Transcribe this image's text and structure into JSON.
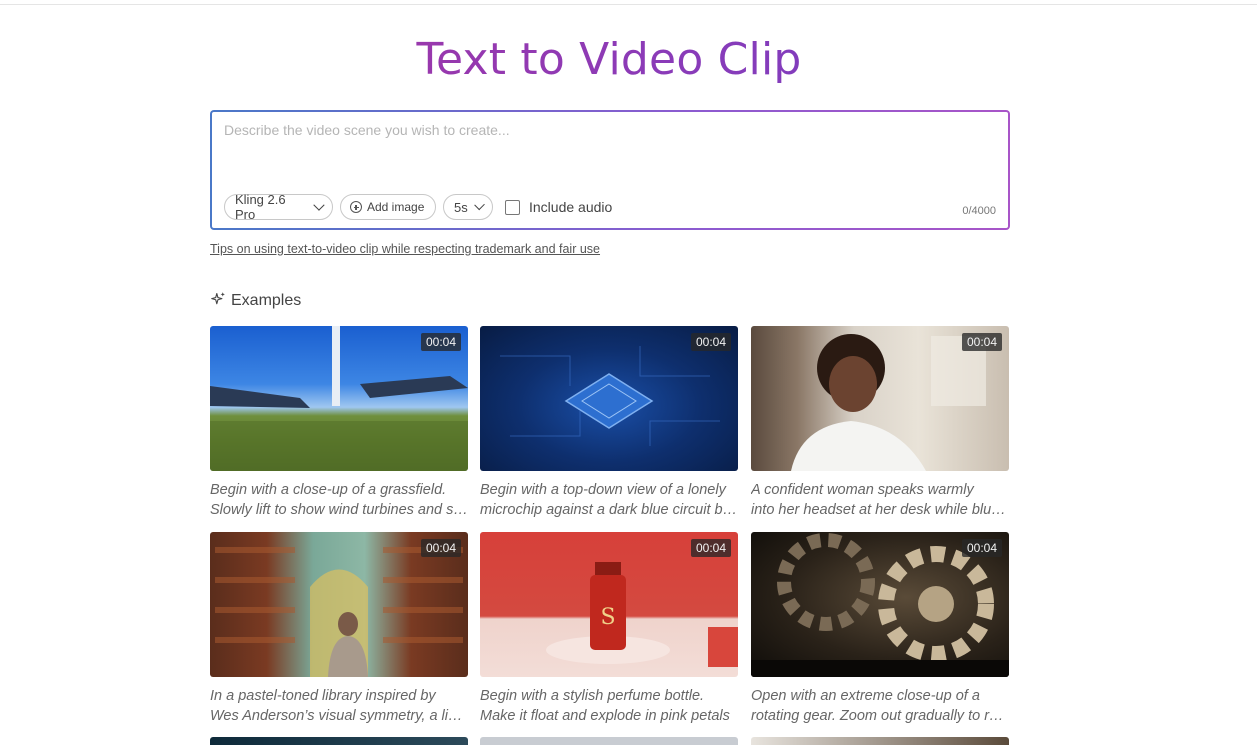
{
  "page": {
    "title": "Text to Video Clip"
  },
  "prompt": {
    "placeholder": "Describe the video scene you wish to create...",
    "model_label": "Kling 2.6 Pro",
    "add_image_label": "Add image",
    "duration_label": "5s",
    "include_audio_label": "Include audio",
    "char_counter": "0/4000"
  },
  "tips_link": "Tips on using text-to-video clip while respecting trademark and fair use",
  "examples": {
    "heading": "Examples",
    "items": [
      {
        "duration": "00:04",
        "line1": "Begin with a close-up of a grassfield.",
        "line2": "Slowly lift to show wind turbines and solar panels"
      },
      {
        "duration": "00:04",
        "line1": "Begin with a top-down view of a lonely",
        "line2": "microchip against a dark blue circuit board"
      },
      {
        "duration": "00:04",
        "line1": "A confident woman speaks warmly",
        "line2": "into her headset at her desk while blurred colleagues"
      },
      {
        "duration": "00:04",
        "line1": "In a pastel-toned library inspired by",
        "line2": "Wes Anderson’s visual symmetry, a librarian"
      },
      {
        "duration": "00:04",
        "line1": "Begin with a stylish perfume bottle.",
        "line2": "Make it float and explode in pink petals"
      },
      {
        "duration": "00:04",
        "line1": "Open with an extreme close-up of a",
        "line2": "rotating gear. Zoom out gradually to reveal"
      }
    ]
  },
  "colors": {
    "title_gradient_start": "#b0329a",
    "title_gradient_end": "#6a3fc9",
    "box_border_start": "#4a78c8",
    "box_border_end": "#a855c8"
  }
}
